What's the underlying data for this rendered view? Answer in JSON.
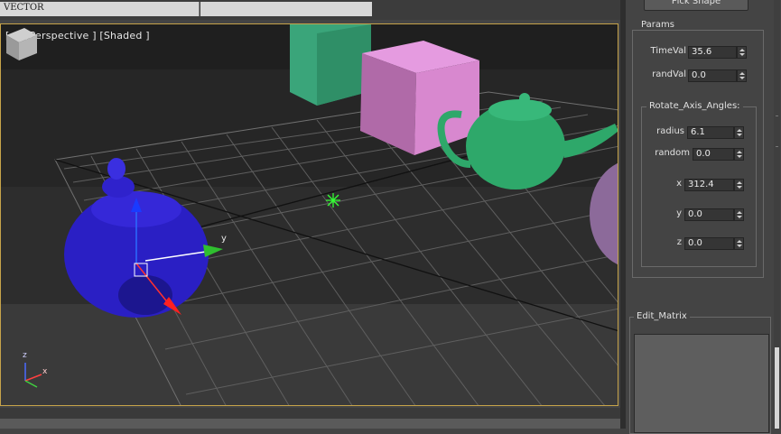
{
  "top_strip": {
    "left_field_text": "VECTOR"
  },
  "viewport": {
    "label": "[+] [Perspective ] [Shaded ]",
    "gizmo_axis_y": "y",
    "mini_axis_z": "z",
    "mini_axis_x": "x",
    "object_colors": {
      "blue_teapot": "#2a1fc4",
      "green_teapot": "#2ea86a",
      "green_box": "#3aa57a",
      "pink_box": "#d27fc8",
      "grid": "#6a6a6a"
    }
  },
  "panel": {
    "pick_shape_button": "Pick Shape",
    "params": {
      "title": "Params",
      "timeval_label": "TimeVal",
      "timeval_value": "35.6",
      "randval_label": "randVal",
      "randval_value": "0.0"
    },
    "rotate": {
      "title": "Rotate_Axis_Angles:",
      "radius_label": "radius",
      "radius_value": "6.1",
      "random_label": "random",
      "random_value": "0.0",
      "x_label": "x",
      "x_value": "312.4",
      "y_label": "y",
      "y_value": "0.0",
      "z_label": "z",
      "z_value": "0.0"
    },
    "edit_matrix": {
      "title": "Edit_Matrix"
    }
  },
  "colors": {
    "viewport_border": "#c7a44a",
    "panel_bg": "#444444"
  }
}
